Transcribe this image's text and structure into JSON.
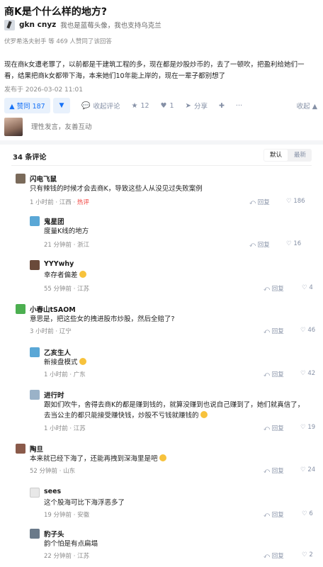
{
  "question": {
    "title": "商K是个什么样的地方?"
  },
  "author": {
    "name": "gkn cnyz",
    "bio": "我也是蓝莓头像，我也支持乌克兰"
  },
  "vote_info": "伏罗希洛夫射手 等 469 人赞同了该回答",
  "article": {
    "text": "现在商k女遭老罪了，以前都是干建筑工程的多，现在都是炒股炒币的，去了一顿吹，把盈利给她们一看，结果把商k女都带下海，本来她们10年能上岸的，现在一辈子都别想了",
    "posted": "发布于 2026-03-02 11:01"
  },
  "actions": {
    "upvote": "▲ 赞同 187",
    "downvote": "▼",
    "comment": "收起评论",
    "favorite": "12",
    "like": "1",
    "share": "分享",
    "more": "✚",
    "collapse": "收起 ▲"
  },
  "comment_box": {
    "placeholder": "理性发言，友善互动"
  },
  "comments_section": {
    "count_label": "34 条评论",
    "sort": {
      "default": "默认",
      "latest": "最新"
    }
  },
  "comments": [
    {
      "name": "闪电飞鼠",
      "text": "只有辣钱的时候才会去商K，导致这些人从没见过失败案例",
      "time": "1 小时前",
      "loc": "江西",
      "hot": "热评",
      "reply": "回复",
      "likes": "186",
      "avatar": "#7a6a5a"
    },
    {
      "name": "鬼星团",
      "text": "度量K线的地方",
      "time": "21 分钟前",
      "loc": "浙江",
      "reply": "回复",
      "likes": "16",
      "avatar": "#5aa7d6"
    },
    {
      "name": "YYYwhy",
      "text": "幸存者偏差",
      "time": "55 分钟前",
      "loc": "江苏",
      "reply": "回复",
      "likes": "4",
      "avatar": "#6a4a3a"
    },
    {
      "name": "小春山tSAOM",
      "text": "意思是，把这些女的拽进股市炒股，然后全赔了?",
      "time": "3 小时前",
      "loc": "辽宁",
      "reply": "回复",
      "likes": "46",
      "avatar": "#4caf50"
    },
    {
      "name": "乙亥生人",
      "text": "新接盘模式",
      "time": "1 小时前",
      "loc": "广东",
      "reply": "回复",
      "likes": "42",
      "avatar": "#5aa7d6"
    },
    {
      "name": "进行时",
      "text": "跟如们吹牛，舍得去商K的都是赚到钱的，就算没赚到也说自己赚到了，她们就真信了，去当公主的都只能接受赚快钱，炒股不亏钱就赚钱的",
      "time": "1 小时前",
      "loc": "江苏",
      "reply": "回复",
      "likes": "19",
      "avatar": "#9ab2c8"
    },
    {
      "name": "陶旦",
      "text": "本来就已经下海了，还能再拽到深海里是吧",
      "time": "52 分钟前",
      "loc": "山东",
      "reply": "回复",
      "likes": "24",
      "avatar": "#8a5a4a"
    },
    {
      "name": "sees",
      "text": "这个股海可比下海浮恶多了",
      "time": "19 分钟前",
      "loc": "安徽",
      "reply": "回复",
      "likes": "6",
      "avatar": "#e8e8e8"
    },
    {
      "name": "豹子头",
      "text": "韵个怕是有点扁塌",
      "time": "22 分钟前",
      "loc": "江苏",
      "reply": "回复",
      "likes": "2",
      "avatar": "#6a7a8a"
    }
  ],
  "colors": {
    "accent": "#1772f6",
    "hot": "#f1403c",
    "muted": "#8590a6"
  }
}
